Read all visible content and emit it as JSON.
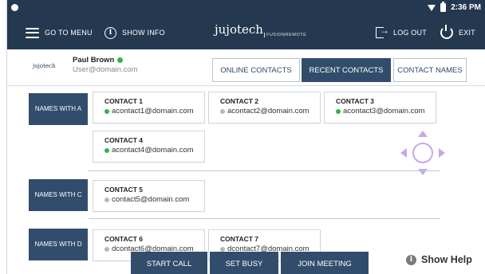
{
  "status": {
    "time": "2:36 PM"
  },
  "nav": {
    "menu_label": "GO TO MENU",
    "info_label": "SHOW INFO",
    "brand_main": "jujotech",
    "brand_sub": "FUSIONREMOTE",
    "logout_label": "LOG OUT",
    "exit_label": "EXIT",
    "color": "#24384f"
  },
  "user": {
    "logo": "jujotech",
    "name": "Paul Brown",
    "email": "User@domain.com",
    "online": true
  },
  "tabs": [
    {
      "label": "ONLINE CONTACTS",
      "active": false
    },
    {
      "label": "RECENT CONTACTS",
      "active": true
    },
    {
      "label": "CONTACT NAMES",
      "active": false
    }
  ],
  "groups": [
    {
      "label": "NAMES WITH A"
    },
    {
      "label": "NAMES WITH C"
    },
    {
      "label": "NAMES WITH D"
    }
  ],
  "contacts": [
    {
      "name": "CONTACT 1",
      "email": "acontact1@domain.com",
      "status": "online"
    },
    {
      "name": "CONTACT 2",
      "email": "acontact2@domain.com",
      "status": "offline"
    },
    {
      "name": "CONTACT 3",
      "email": "acontact3@domain.com",
      "status": "online"
    },
    {
      "name": "CONTACT 4",
      "email": "acontact4@domain.com",
      "status": "online"
    },
    {
      "name": "CONTACT 5",
      "email": "contact5@domain.com",
      "status": "offline"
    },
    {
      "name": "CONTACT 6",
      "email": "dcontact6@domain.com",
      "status": "offline"
    },
    {
      "name": "CONTACT 7",
      "email": "dcontact7@domain.com",
      "status": "offline"
    }
  ],
  "status_colors": {
    "online": "#2fb44a",
    "offline": "#b8b8b8"
  },
  "actions": {
    "start_call": "START CALL",
    "set_busy": "SET BUSY",
    "join_meeting": "JOIN MEETING",
    "help": "Show Help"
  },
  "icons": [
    "hamburger-icon",
    "info-icon",
    "logout-icon",
    "power-icon",
    "wifi-icon",
    "battery-icon",
    "dpad-icon",
    "help-icon"
  ]
}
